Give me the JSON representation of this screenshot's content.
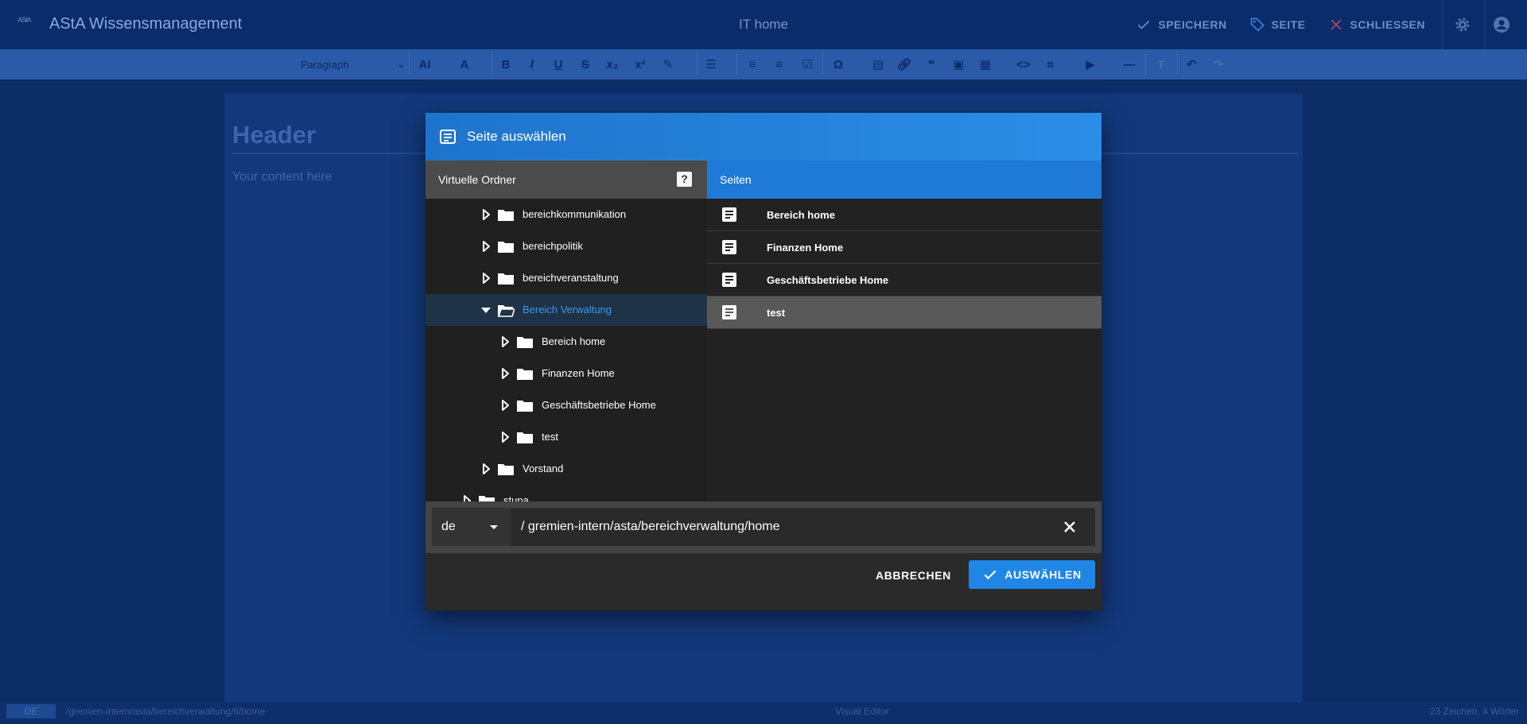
{
  "app": {
    "logo_text": "AStA",
    "title": "AStA Wissensmanagement",
    "page_title": "IT home",
    "actions": {
      "save": "SPEICHERN",
      "page": "SEITE",
      "close": "SCHLIESSEN"
    }
  },
  "toolbar": {
    "paragraph": "Paragraph",
    "buttons": [
      "font-size",
      "superscript-size",
      "bold",
      "italic",
      "underline",
      "strikethrough",
      "subscript",
      "superscript",
      "highlight",
      "align",
      "ordered-list",
      "bullet-list",
      "todo-list",
      "special-characters",
      "page-link",
      "link",
      "blockquote",
      "image",
      "table",
      "code",
      "code-block",
      "media",
      "horizontal-line",
      "remove-format",
      "undo",
      "redo"
    ]
  },
  "editor": {
    "header": "Header",
    "content": "Your content here"
  },
  "status": {
    "lang": "DE",
    "path": "/gremien-intern/asta/bereichverwaltung/it/home",
    "mode": "Visual Editor",
    "count": "23 Zeichen, 4 Wörter"
  },
  "modal": {
    "title": "Seite auswählen",
    "left_header": "Virtuelle Ordner",
    "help": "?",
    "right_header": "Seiten",
    "tree": [
      {
        "label": "bereichkommunikation",
        "level": 2,
        "expanded": false,
        "active": false
      },
      {
        "label": "bereichpolitik",
        "level": 2,
        "expanded": false,
        "active": false
      },
      {
        "label": "bereichveranstaltung",
        "level": 2,
        "expanded": false,
        "active": false
      },
      {
        "label": "Bereich Verwaltung",
        "level": 2,
        "expanded": true,
        "active": true
      },
      {
        "label": "Bereich home",
        "level": 3,
        "expanded": false,
        "active": false
      },
      {
        "label": "Finanzen Home",
        "level": 3,
        "expanded": false,
        "active": false
      },
      {
        "label": "Geschäftsbetriebe Home",
        "level": 3,
        "expanded": false,
        "active": false
      },
      {
        "label": "test",
        "level": 3,
        "expanded": false,
        "active": false
      },
      {
        "label": "Vorstand",
        "level": 2,
        "expanded": false,
        "active": false
      },
      {
        "label": "stupa",
        "level": 1,
        "expanded": false,
        "active": false
      }
    ],
    "pages": [
      {
        "label": "Bereich home",
        "selected": false
      },
      {
        "label": "Finanzen Home",
        "selected": false
      },
      {
        "label": "Geschäftsbetriebe Home",
        "selected": false
      },
      {
        "label": "test",
        "selected": true
      }
    ],
    "lang": "de",
    "path": "/ gremien-intern/asta/bereichverwaltung/home",
    "cancel": "ABBRECHEN",
    "ok": "AUSWÄHLEN"
  },
  "colors": {
    "accent": "#1f86e6",
    "active_folder": "#3a98f0",
    "appbar": "#0a2c6a",
    "toolbar": "#2b5aa8"
  }
}
